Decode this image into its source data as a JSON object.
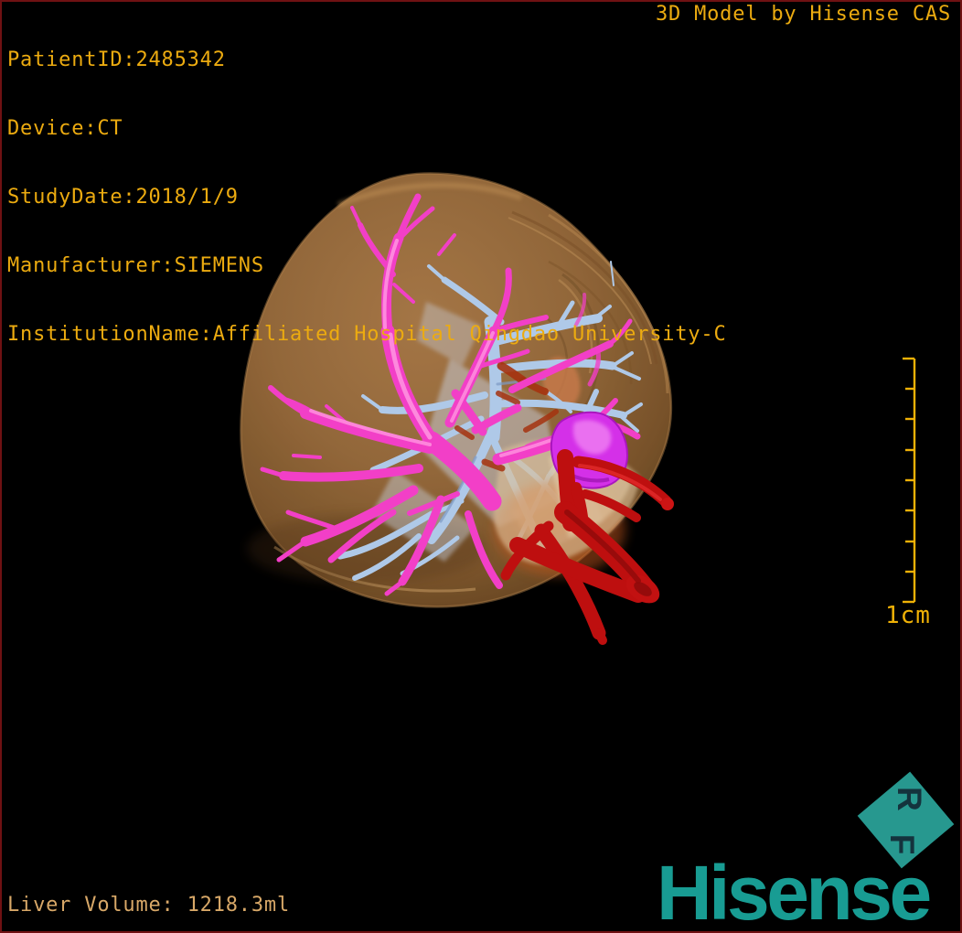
{
  "overlay": {
    "patient_info": [
      "PatientID:2485342",
      "Device:CT",
      "StudyDate:2018/1/9",
      "Manufacturer:SIEMENS",
      "InstitutionName:Affiliated Hospital Qingdao University-C"
    ],
    "watermark": "3D Model by Hisense CAS",
    "liver_volume": "Liver Volume: 1218.3ml"
  },
  "scale_bar": {
    "label": "1cm",
    "tick_count": 9,
    "interval_cm": 1
  },
  "branding": {
    "wordmark": "Hisense",
    "rf_r": "R",
    "rf_f": "F"
  },
  "model": {
    "structures": [
      {
        "name": "liver-capsule",
        "color": "#9C6E3E",
        "style": "translucent"
      },
      {
        "name": "portal-vein-tree",
        "color": "#F23FC7"
      },
      {
        "name": "hepatic-vein-tree",
        "color": "#AFC9E8"
      },
      {
        "name": "artery-ivc-tree",
        "color": "#BE0F0F"
      },
      {
        "name": "tumor",
        "color": "#D430E8"
      },
      {
        "name": "resection-plane",
        "color": "#C7D0DD"
      }
    ]
  },
  "colors": {
    "overlay_text": "#ECAB10",
    "volume_text": "#D8A868",
    "scale_bar": "#EFB106",
    "brand_teal": "#189C93",
    "rf_diamond": "#27988F",
    "viewport_border": "#6F1113",
    "background": "#000000"
  }
}
